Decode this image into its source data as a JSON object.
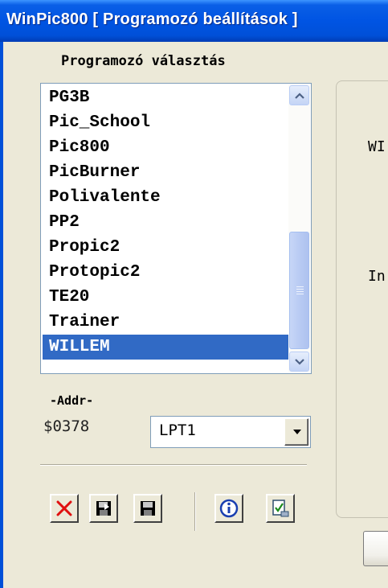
{
  "window": {
    "title": "WinPic800 [ Programozó beállítások ]"
  },
  "programmer": {
    "caption": "Programozó választás",
    "items": [
      "PG3B",
      "Pic_School",
      "Pic800",
      "PicBurner",
      "Polivalente",
      "PP2",
      "Propic2",
      "Protopic2",
      "TE20",
      "Trainer",
      "WILLEM"
    ],
    "selected": "WILLEM",
    "selected_index": 10,
    "scrollbar": {
      "thumb_start": 0.56,
      "thumb_size": 0.45
    }
  },
  "address": {
    "label": "-Addr-",
    "value": "$0378"
  },
  "port": {
    "selected": "LPT1"
  },
  "toolbar": {
    "buttons": [
      {
        "name": "delete-button",
        "icon": "red-x-icon"
      },
      {
        "name": "load-button",
        "icon": "floppy-load-icon"
      },
      {
        "name": "save-button",
        "icon": "floppy-save-icon"
      },
      {
        "name": "info-button",
        "icon": "info-icon"
      },
      {
        "name": "test-button",
        "icon": "document-check-icon"
      }
    ]
  },
  "right_panel": {
    "text1": "WI",
    "text2": "In"
  },
  "colors": {
    "titlebar": "#0054e3",
    "selection": "#316ac5",
    "window": "#ece9d8",
    "delete": "#e01010",
    "info": "#1a3fb0"
  }
}
